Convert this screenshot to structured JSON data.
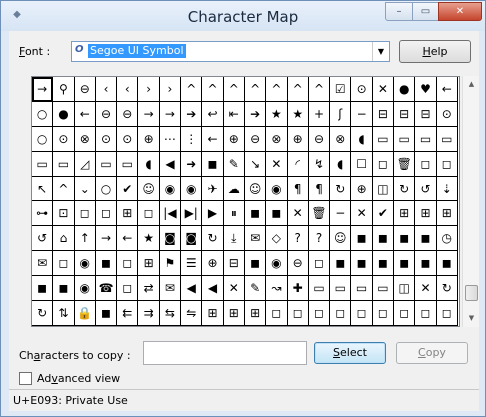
{
  "window": {
    "title": "Character Map",
    "close_glyph": "✕",
    "min_glyph": "–",
    "max_glyph": "▭"
  },
  "font": {
    "label": "Font :",
    "selected": "Segoe UI Symbol",
    "font_icon": "O"
  },
  "help_label": "Help",
  "grid": {
    "selected_index": 0,
    "rows": [
      [
        "→",
        "⚲",
        "⊖",
        "‹",
        "‹",
        "›",
        "›",
        "^",
        "^",
        "^",
        "^",
        "^",
        "^",
        "^",
        "☑",
        "⊙",
        "✕",
        "●",
        "♥",
        "←"
      ],
      [
        "○",
        "●",
        "←",
        "⊖",
        "⊖",
        "→",
        "→",
        "➔",
        "↩",
        "⇤",
        "➔",
        "★",
        "★",
        "+",
        "ʃ",
        "−",
        "⊟",
        "⊟",
        "⊟",
        "⊙"
      ],
      [
        "○",
        "⊙",
        "⊗",
        "⊙",
        "⊙",
        "⊕",
        "⋯",
        "⋮",
        "←",
        "⊕",
        "⊖",
        "⊗",
        "⊕",
        "⊖",
        "⊗",
        "◖",
        "▭",
        "▭",
        "▭",
        "▭"
      ],
      [
        "▭",
        "▭",
        "◿",
        "▭",
        "▭",
        "◖",
        "◀",
        "➜",
        "◼",
        "✎",
        "↘",
        "✕",
        "◜",
        "↯",
        "◖",
        "☐",
        "◻",
        "🗑",
        "◻",
        "◻"
      ],
      [
        "↖",
        "^",
        "⌄",
        "○",
        "✔",
        "☺",
        "◉",
        "◉",
        "✈",
        "☁",
        "☺",
        "◉",
        "¶",
        "¶",
        "↻",
        "⊕",
        "◫",
        "↻",
        "↺",
        "⇣"
      ],
      [
        "⊶",
        "⊡",
        "◻",
        "◻",
        "⊞",
        "◻",
        "|◀",
        "▶|",
        "▶",
        "⏸",
        "◼",
        "◼",
        "✕",
        "🗑",
        "−",
        "✕",
        "✔",
        "⊞",
        "⊞",
        "⊞"
      ],
      [
        "↺",
        "⌂",
        "↑",
        "→",
        "←",
        "★",
        "◙",
        "◙",
        "↻",
        "⤓",
        "✉",
        "◇",
        "?",
        "?",
        "☺",
        "◼",
        "◼",
        "◼",
        "◼",
        "◷"
      ],
      [
        "✉",
        "◻",
        "◉",
        "◼",
        "◻",
        "⊞",
        "⚑",
        "☰",
        "⊕",
        "⊟",
        "◼",
        "◉",
        "⊖",
        "◻",
        "◼",
        "◼",
        "◼",
        "◼",
        "◼",
        "◼"
      ],
      [
        "◼",
        "◼",
        "◉",
        "☎",
        "◻",
        "⇄",
        "✉",
        "◀",
        "◀",
        "✕",
        "✎",
        "↝",
        "✚",
        "▭",
        "▭",
        "▭",
        "▭",
        "◫",
        "✕",
        "↻"
      ],
      [
        "↻",
        "⇅",
        "🔒",
        "◼",
        "⇇",
        "⇉",
        "⇆",
        "⇋",
        "⊞",
        "⊞",
        "⊞",
        "◻",
        "◻",
        "◻",
        "◻",
        "◻",
        "◻",
        "◻",
        "◻",
        "◻"
      ]
    ]
  },
  "scroll": {
    "up_glyph": "▲",
    "down_glyph": "▼"
  },
  "copy": {
    "label": "Characters to copy :",
    "value": "",
    "select_label": "Select",
    "copy_label": "Copy"
  },
  "advanced": {
    "label": "Advanced view",
    "checked": false
  },
  "status": {
    "text": "U+E093: Private Use"
  }
}
